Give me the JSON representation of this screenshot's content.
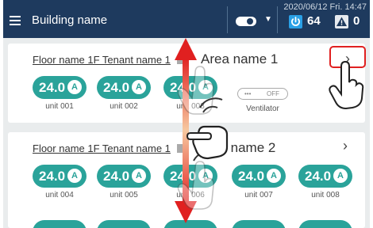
{
  "header": {
    "building_name": "Building name",
    "datetime": "2020/06/12 Fri. 14:47",
    "power_count": "64",
    "warning_count": "0"
  },
  "cards": [
    {
      "floor_title": "Floor name 1F Tenant name 1",
      "area_name": "Area name 1",
      "units": [
        {
          "temp": "24.0",
          "mode": "A",
          "label": "unit 001"
        },
        {
          "temp": "24.0",
          "mode": "A",
          "label": "unit 002"
        },
        {
          "temp": "24.0",
          "mode": "A",
          "label": "unit 003"
        }
      ],
      "ventilator": {
        "state": "OFF",
        "label": "Ventilator"
      }
    },
    {
      "floor_title": "Floor name 1F Tenant name 1",
      "area_name": "Area name 2",
      "units": [
        {
          "temp": "24.0",
          "mode": "A",
          "label": "unit 004"
        },
        {
          "temp": "24.0",
          "mode": "A",
          "label": "unit 005"
        },
        {
          "temp": "24.0",
          "mode": "A",
          "label": "unit 006"
        },
        {
          "temp": "24.0",
          "mode": "A",
          "label": "unit 007"
        },
        {
          "temp": "24.0",
          "mode": "A",
          "label": "unit 008"
        }
      ]
    }
  ],
  "colors": {
    "header_bg": "#1e3a5e",
    "unit_pill": "#2aa39a",
    "highlight_border": "#e02020",
    "scroll_arrow": "#e02020"
  },
  "icons": {
    "menu": "hamburger-icon",
    "toggle": "toggle-icon",
    "power": "power-icon",
    "warning": "warning-icon",
    "chevron": "chevron-right-icon",
    "gesture": "scroll-gesture-hand-icon",
    "tap": "tap-hand-icon"
  }
}
